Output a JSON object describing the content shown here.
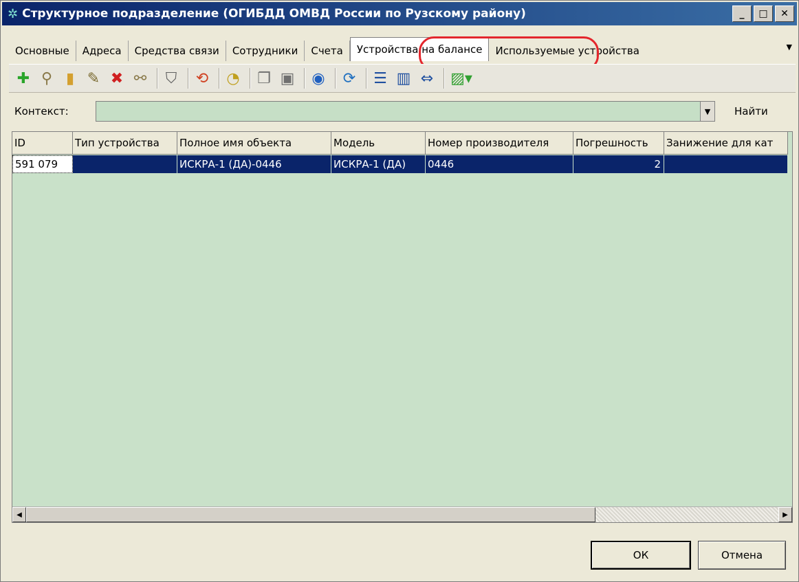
{
  "window": {
    "title": "Структурное подразделение (ОГИБДД ОМВД России по Рузскому району)",
    "controls": {
      "minimize": "_",
      "maximize": "□",
      "close": "✕"
    }
  },
  "tabs": [
    {
      "label": "Основные",
      "active": false
    },
    {
      "label": "Адреса",
      "active": false
    },
    {
      "label": "Средства связи",
      "active": false
    },
    {
      "label": "Сотрудники",
      "active": false
    },
    {
      "label": "Счета",
      "active": false
    },
    {
      "label": "Устройства на балансе",
      "active": true
    },
    {
      "label": "Используемые устройства",
      "active": false
    }
  ],
  "toolbar_icons": [
    "add-icon",
    "link-icon",
    "paste-icon",
    "edit-icon",
    "delete-icon",
    "unlink-icon",
    "filter-icon",
    "refresh-red-icon",
    "history-icon",
    "copy-icon",
    "new-window-icon",
    "globe-icon",
    "refresh-icon",
    "list-icon",
    "columns-icon",
    "fit-icon",
    "chart-dropdown-icon"
  ],
  "context": {
    "label": "Контекст:",
    "value": "",
    "find_label": "Найти"
  },
  "grid": {
    "columns": [
      "ID",
      "Тип устройства",
      "Полное имя объекта",
      "Модель",
      "Номер производителя",
      "Погрешность",
      "Занижение для кат"
    ],
    "rows": [
      [
        "591 079",
        "",
        "ИСКРА-1 (ДА)-0446",
        "ИСКРА-1 (ДА)",
        "0446",
        "2",
        ""
      ]
    ]
  },
  "buttons": {
    "ok": "ОК",
    "cancel": "Отмена"
  },
  "colors": {
    "title_start": "#0a246a",
    "selection": "#0a246a",
    "grid_bg": "#c9e1c9",
    "highlight": "#e3262c"
  }
}
